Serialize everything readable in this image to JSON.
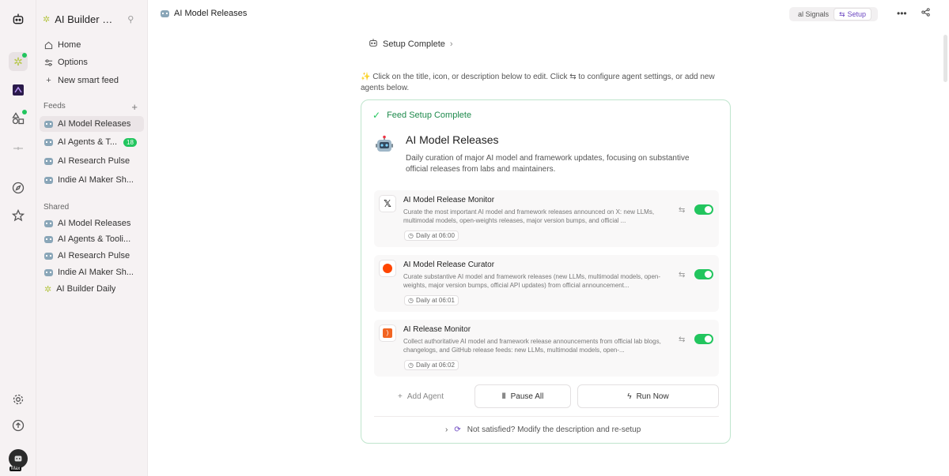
{
  "app": {
    "workspace_name": "AI Builder Da...",
    "page_title": "AI Model Releases",
    "user_label": "Max"
  },
  "sidebar": {
    "top_items": [
      {
        "label": "Home",
        "icon": "home-icon"
      },
      {
        "label": "Options",
        "icon": "sliders-icon"
      },
      {
        "label": "New smart feed",
        "icon": "plus-icon"
      }
    ],
    "feeds_header": "Feeds",
    "feeds": [
      {
        "label": "AI Model Releases",
        "active": true
      },
      {
        "label": "AI Agents & T...",
        "badge": "18"
      },
      {
        "label": "AI Research Pulse"
      },
      {
        "label": "Indie AI Maker Sh..."
      }
    ],
    "shared_header": "Shared",
    "shared": [
      {
        "label": "AI Model Releases"
      },
      {
        "label": "AI Agents & Tooli..."
      },
      {
        "label": "AI Research Pulse"
      },
      {
        "label": "Indie AI Maker Sh..."
      },
      {
        "label": "AI Builder Daily"
      }
    ]
  },
  "topbar": {
    "segment_signals": "al Signals",
    "segment_setup": "Setup",
    "more_icon": "more-horizontal-icon",
    "share_icon": "share-icon"
  },
  "main": {
    "breadcrumb": "Setup Complete",
    "hint": "✨ Click on the title, icon, or description below to edit. Click ⇆ to configure agent settings, or add new agents below.",
    "status": "Feed Setup Complete",
    "feed_title": "AI Model Releases",
    "feed_description": "Daily curation of major AI model and framework updates, focusing on substantive official releases from labs and maintainers.",
    "agents": [
      {
        "name": "AI Model Release Monitor",
        "source_icon": "x-logo-icon",
        "description": "Curate the most important AI model and framework releases announced on X: new LLMs, multimodal models, open-weights releases, major version bumps, and official ...",
        "schedule": "Daily at 06:00",
        "enabled": true
      },
      {
        "name": "AI Model Release Curator",
        "source_icon": "reddit-logo-icon",
        "description": "Curate substantive AI model and framework releases (new LLMs, multimodal models, open-weights, major version bumps, official API updates) from official announcement...",
        "schedule": "Daily at 06:01",
        "enabled": true
      },
      {
        "name": "AI Release Monitor",
        "source_icon": "rss-icon",
        "description": "Collect authoritative AI model and framework release announcements from official lab blogs, changelogs, and GitHub release feeds: new LLMs, multimodal models, open-...",
        "schedule": "Daily at 06:02",
        "enabled": true
      }
    ],
    "add_agent": "Add Agent",
    "pause_all": "Pause All",
    "run_now": "Run Now",
    "resetup": "Not satisfied? Modify the description and re-setup"
  },
  "colors": {
    "accent_green": "#22c55e",
    "status_text_green": "#1e8a4c",
    "setup_purple": "#6b46c1",
    "sidebar_bg": "#f6f2f3"
  }
}
